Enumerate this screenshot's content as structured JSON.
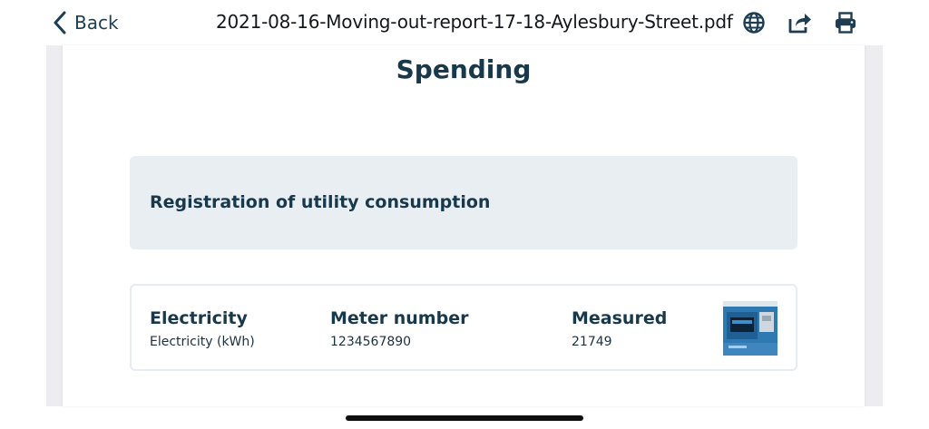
{
  "header": {
    "back_label": "Back",
    "document_title": "2021-08-16-Moving-out-report-17-18-Aylesbury-Street.pdf",
    "icons": [
      "globe-icon",
      "share-icon",
      "print-icon"
    ],
    "accent_color": "#1c3d52"
  },
  "page": {
    "section_title": "Spending",
    "registration_label": "Registration of utility consumption",
    "meter": {
      "type_heading": "Electricity",
      "type_value": "Electricity (kWh)",
      "number_heading": "Meter number",
      "number_value": "1234567890",
      "measured_heading": "Measured",
      "measured_value": "21749",
      "photo": "meter-photo-thumbnail"
    }
  }
}
